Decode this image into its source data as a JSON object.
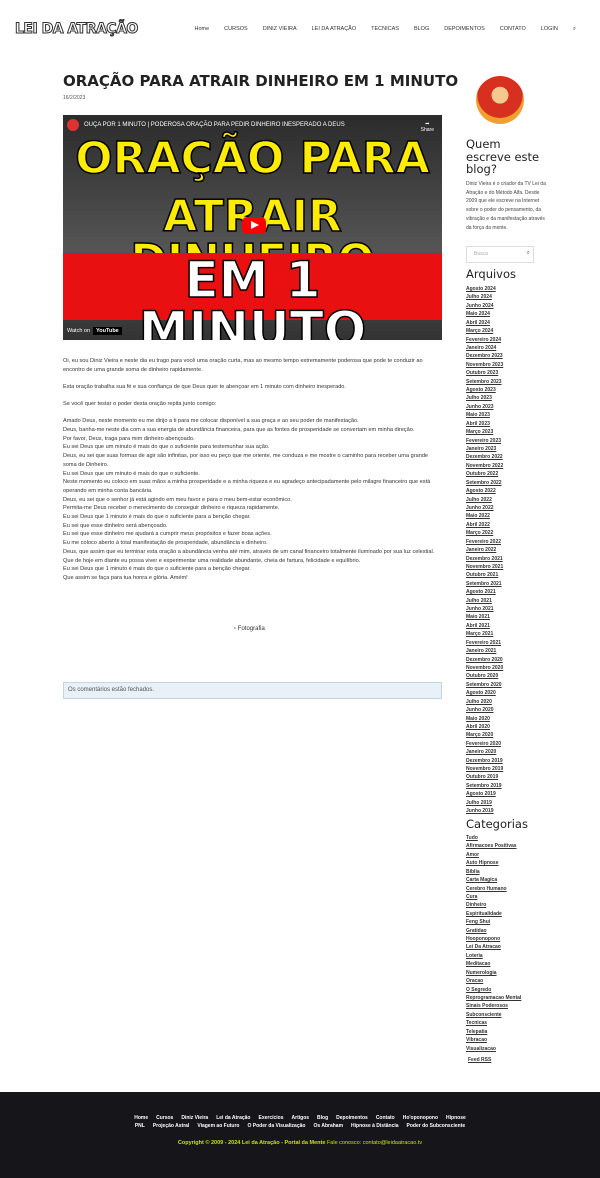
{
  "header": {
    "logo": "LEI DA ATRAÇÃO",
    "nav": [
      "Home",
      "CURSOS",
      "DINIZ VIEIRA",
      "LEI DA ATRAÇÃO",
      "TECNICAS",
      "BLOG",
      "DEPOIMENTOS",
      "CONTATO",
      "LOGIN"
    ]
  },
  "post": {
    "title": "ORAÇÃO PARA ATRAIR DINHEIRO EM 1 MINUTO",
    "date": "16/2/2023",
    "video": {
      "title": "OUÇA POR 1 MINUTO | PODEROSA ORAÇÃO PARA PEDIR DINHEIRO INESPERADO A DEUS",
      "share": "Share",
      "line1": "ORAÇÃO PARA",
      "line2": "ATRAIR DINHEIRO",
      "line3": "EM 1 MINUTO",
      "watch": "Watch on",
      "yt": "YouTube"
    },
    "paragraphs": [
      "Oi, eu sou Diniz Vieira e neste dia eu trago para você uma oração curta, mas ao mesmo tempo extremamente poderosa que pode te conduzir ao encontro de uma grande soma de dinheiro rapidamente.",
      "Esta oração trabalha sua fé e sua confiança de que Deus quer te abençoar em 1 minuto com dinheiro inesperado.",
      "Se você quer testar o poder desta oração repita junto comigo:"
    ],
    "prayer": [
      "Amado Deus, neste momento eu me dirijo a ti para me colocar disponível a sua graça e ao seu poder de manifestação.",
      "Deus, banha-me neste dia com a sua energia de abundância financeira, para que as fontes de prosperidade se convertam em minha direção.",
      "Por favor, Deus, traga para mim dinheiro abençoado.",
      "Eu sei Deus que um minuto é mais do que o suficiente para testemunhar sua ação.",
      "Deus, eu sei que suas formas de agir são infinitas, por isso eu peço que me oriente, me conduza e me mostre o caminho para receber uma grande soma de Dinheiro.",
      "Eu sei Deus que um minuto é mais do que o suficiente.",
      "Neste momento eu coloco em suas mãos a minha prosperidade e a minha riqueza e eu agradeço antecipadamente pelo milagre financeiro que está operando em minha conta bancária.",
      "Deus, eu sei que o senhor já está agindo em meu favor e para o meu bem-estar econômico.",
      "Permita-me Deus receber o merecimento de conseguir dinheiro e riqueza rapidamente.",
      "Eu sei Deus que 1 minuto é mais do que o suficiente para a benção chegar.",
      "Eu sei que esse dinheiro será abençoado.",
      "Eu sei que esse dinheiro me ajudará a cumprir meus propósitos e fazer boas ações.",
      "Eu me coloco aberto à total manifestação de prosperidade, abundância e dinheiro.",
      "Deus, que assim que eu terminar esta oração a abundância venha até mim, através de um canal financeiro totalmente iluminado por sua luz celestial.",
      "Que de hoje em diante eu possa viver e experimentar uma realidade abundante, cheia de fartura, felicidade e equilíbrio.",
      "Eu sei Deus que 1 minuto é mais do que o suficiente para a benção chegar.",
      "Que assim se faça para tua honra e glória. Amém!"
    ],
    "image_alt": "Fotografia",
    "comments": "Os comentários estão fechados."
  },
  "sidebar": {
    "about_title": "Quem escreve este blog?",
    "about": "Diniz Vieira é o criador da TV Lei da Atração e do Método Alfa. Desde 2009 que ele escreve na Internet sobre o poder do pensamento, da vibração e da manifestação através da força da mente.",
    "search_placeholder": "Busca",
    "archives_title": "Arquivos",
    "archives": [
      "Agosto 2024",
      "Julho 2024",
      "Junho 2024",
      "Maio 2024",
      "Abril 2024",
      "Março 2024",
      "Fevereiro 2024",
      "Janeiro 2024",
      "Dezembro 2023",
      "Novembro 2023",
      "Outubro 2023",
      "Setembro 2023",
      "Agosto 2023",
      "Julho 2023",
      "Junho 2023",
      "Maio 2023",
      "Abril 2023",
      "Março 2023",
      "Fevereiro 2023",
      "Janeiro 2023",
      "Dezembro 2022",
      "Novembro 2022",
      "Outubro 2022",
      "Setembro 2022",
      "Agosto 2022",
      "Julho 2022",
      "Junho 2022",
      "Maio 2022",
      "Abril 2022",
      "Março 2022",
      "Fevereiro 2022",
      "Janeiro 2022",
      "Dezembro 2021",
      "Novembro 2021",
      "Outubro 2021",
      "Setembro 2021",
      "Agosto 2021",
      "Julho 2021",
      "Junho 2021",
      "Maio 2021",
      "Abril 2021",
      "Março 2021",
      "Fevereiro 2021",
      "Janeiro 2021",
      "Dezembro 2020",
      "Novembro 2020",
      "Outubro 2020",
      "Setembro 2020",
      "Agosto 2020",
      "Julho 2020",
      "Junho 2020",
      "Maio 2020",
      "Abril 2020",
      "Março 2020",
      "Fevereiro 2020",
      "Janeiro 2020",
      "Dezembro 2019",
      "Novembro 2019",
      "Outubro 2019",
      "Setembro 2019",
      "Agosto 2019",
      "Julho 2019",
      "Junho 2019"
    ],
    "categories_title": "Categorias",
    "categories": [
      "Tudo",
      "Afirmacoes Positivas",
      "Amor",
      "Auto Hipnose",
      "Bíblia",
      "Carta Magica",
      "Cerebro Humano",
      "Cura",
      "Dinheiro",
      "Espiritualidade",
      "Feng Shui",
      "Gratidao",
      "Hooponopono",
      "Lei Da Atracao",
      "Loteria",
      "Meditacao",
      "Numerologia",
      "Oracao",
      "O Segredo",
      "Reprogramacao Mental",
      "Sinais Poderosos",
      "Subconsciente",
      "Tecnicas",
      "Telepatia",
      "Vibracao",
      "Visualizacao"
    ],
    "feed": "Feed RSS"
  },
  "footer": {
    "row1": [
      "Home",
      "Cursos",
      "Diniz Vieira",
      "Lei da Atração",
      "Exercícios",
      "Artigos",
      "Blog",
      "Depoimentos",
      "Contato",
      "Ho'oponopono",
      "Hipnose"
    ],
    "row2": [
      "PNL",
      "Projeção Astral",
      "Viagem ao Futuro",
      "O Poder da Visualização",
      "Os Abraham",
      "Hipnose à Distância",
      "Poder do Subconsciente"
    ],
    "copyright": "Copyright © 2009 - 2024 Lei da Atração - Portal da Mente",
    "contact": "Fale conosco: contato@leidaatracao.tv"
  }
}
